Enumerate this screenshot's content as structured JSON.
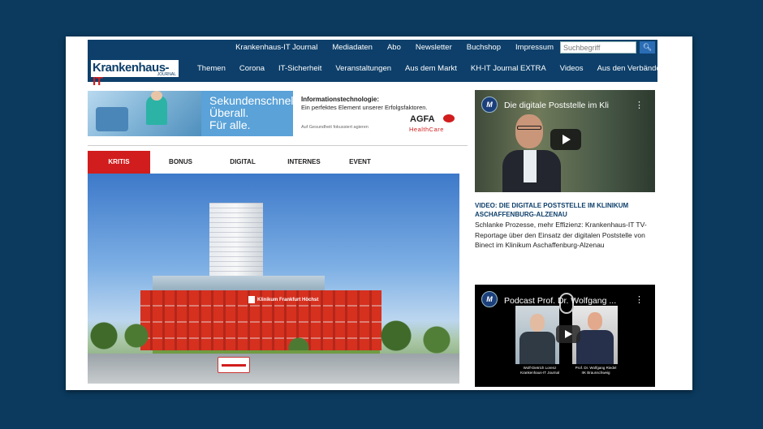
{
  "topnav": [
    "Krankenhaus-IT Journal",
    "Mediadaten",
    "Abo",
    "Newsletter",
    "Buchshop",
    "Impressum"
  ],
  "search": {
    "placeholder": "Suchbegriff",
    "button_icon": "search-icon"
  },
  "logo": {
    "main": "Krankenhaus-",
    "accent": "IT",
    "sub": "JOURNAL"
  },
  "mainnav": [
    "Themen",
    "Corona",
    "IT-Sicherheit",
    "Veranstaltungen",
    "Aus dem Markt",
    "KH-IT Journal EXTRA",
    "Videos",
    "Aus den Verbänden"
  ],
  "ad": {
    "slogan_1": "Sekundenschnell.",
    "slogan_2": "Überall.",
    "slogan_3": "Für alle.",
    "title": "Informationstechnologie:",
    "desc": "Ein perfektes Element unserer Erfolgsfaktoren.",
    "small": "Auf Gesundheit fokussiert agieren",
    "brand": "AGFA",
    "brand_sub": "HealthCare"
  },
  "tabs": [
    "KRITIS",
    "BONUS",
    "DIGITAL",
    "INTERNES",
    "EVENT"
  ],
  "hero": {
    "sign": "Klinikum Frankfurt Höchst"
  },
  "video1": {
    "title": "Die digitale Poststelle im Kli",
    "menu": "⋮",
    "channel": "M"
  },
  "article": {
    "headline": "VIDEO: DIE DIGITALE POSTSTELLE IM KLINIKUM ASCHAFFENBURG-ALZENAU",
    "text": "Schlanke Prozesse, mehr Effizienz: Krankenhaus-IT TV-Reportage über den Einsatz der digitalen Poststelle von Binect im Klinikum Aschaffenburg-Alzenau"
  },
  "video2": {
    "title": "Podcast Prof. Dr. Wolfgang ...",
    "menu": "⋮",
    "channel": "M",
    "caption_1": "Wolf-Dietrich Lorenz\nKrankenhaus-IT Journal",
    "caption_2": "Prof. Dr. Wolfgang Riedel\nIIK Braunschweig"
  },
  "colors": {
    "background": "#0b3a5e",
    "header": "#0d3f6a",
    "accent": "#d11d1d",
    "ad_blue": "#5aa2d8"
  }
}
